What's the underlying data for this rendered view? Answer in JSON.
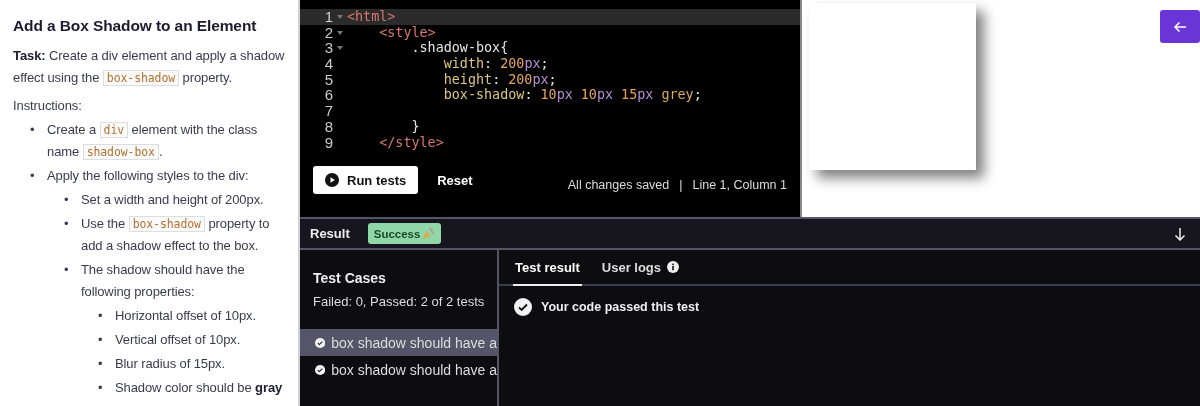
{
  "instructions": {
    "title": "Add a Box Shadow to an Element",
    "task": [
      {
        "kind": "text",
        "t": "**Task:** Create a div element and apply a shadow effect using the "
      },
      {
        "kind": "code",
        "t": "box-shadow"
      },
      {
        "kind": "text",
        "t": " property."
      }
    ],
    "subtitle": "Instructions:",
    "items": [
      {
        "bullet": "•",
        "parts": [
          {
            "kind": "text",
            "t": "Create a "
          },
          {
            "kind": "code",
            "t": "div"
          },
          {
            "kind": "text",
            "t": " element with the class name "
          },
          {
            "kind": "code",
            "t": "shadow-box"
          },
          {
            "kind": "text",
            "t": "."
          }
        ]
      },
      {
        "bullet": "•",
        "parts": [
          {
            "kind": "text",
            "t": "Apply the following styles to the div:"
          }
        ],
        "children": [
          {
            "bullet": "•",
            "parts": [
              {
                "kind": "text",
                "t": "Set a width and height of 200px."
              }
            ]
          },
          {
            "bullet": "•",
            "parts": [
              {
                "kind": "text",
                "t": "Use the "
              },
              {
                "kind": "code",
                "t": "box-shadow"
              },
              {
                "kind": "text",
                "t": " property to add a shadow effect to the box."
              }
            ]
          },
          {
            "bullet": "•",
            "parts": [
              {
                "kind": "text",
                "t": "The shadow should have the following properties:"
              }
            ],
            "children": [
              {
                "bullet": "•",
                "parts": [
                  {
                    "kind": "text",
                    "t": "Horizontal offset of 10px."
                  }
                ]
              },
              {
                "bullet": "•",
                "parts": [
                  {
                    "kind": "text",
                    "t": "Vertical offset of 10px."
                  }
                ]
              },
              {
                "bullet": "•",
                "parts": [
                  {
                    "kind": "text",
                    "t": "Blur radius of 15px."
                  }
                ]
              },
              {
                "bullet": "•",
                "parts": [
                  {
                    "kind": "text",
                    "t": "Shadow color should be **gray**"
                  }
                ]
              }
            ]
          }
        ]
      }
    ]
  },
  "editor": {
    "lines": [
      {
        "number": "1",
        "fold": true,
        "active": true,
        "tokens": [
          {
            "kind": "tag",
            "t": "<html>"
          }
        ]
      },
      {
        "number": "2",
        "fold": true,
        "active": false,
        "tokens": [
          {
            "kind": "tag",
            "t": "    <style>"
          }
        ]
      },
      {
        "number": "3",
        "fold": true,
        "active": false,
        "tokens": [
          {
            "kind": "plain",
            "t": "        .shadow-box{"
          }
        ]
      },
      {
        "number": "4",
        "fold": false,
        "active": false,
        "tokens": [
          {
            "kind": "prop",
            "t": "            width"
          },
          {
            "kind": "plain",
            "t": ":"
          },
          {
            "kind": "num",
            "t": " 200"
          },
          {
            "kind": "unit",
            "t": "px"
          },
          {
            "kind": "plain",
            "t": ";"
          }
        ]
      },
      {
        "number": "5",
        "fold": false,
        "active": false,
        "tokens": [
          {
            "kind": "prop",
            "t": "            height"
          },
          {
            "kind": "plain",
            "t": ":"
          },
          {
            "kind": "num",
            "t": " 200"
          },
          {
            "kind": "unit",
            "t": "px"
          },
          {
            "kind": "plain",
            "t": ";"
          }
        ]
      },
      {
        "number": "6",
        "fold": false,
        "active": false,
        "tokens": [
          {
            "kind": "prop",
            "t": "            box-shadow"
          },
          {
            "kind": "plain",
            "t": ":"
          },
          {
            "kind": "num",
            "t": " 10"
          },
          {
            "kind": "unit",
            "t": "px"
          },
          {
            "kind": "num",
            "t": " 10"
          },
          {
            "kind": "unit",
            "t": "px"
          },
          {
            "kind": "num",
            "t": " 15"
          },
          {
            "kind": "unit",
            "t": "px"
          },
          {
            "kind": "value",
            "t": " grey"
          },
          {
            "kind": "plain",
            "t": ";"
          }
        ]
      },
      {
        "number": "7",
        "fold": false,
        "active": false
      },
      {
        "number": "8",
        "fold": false,
        "active": false,
        "tokens": [
          {
            "kind": "plain",
            "t": "        }"
          }
        ]
      },
      {
        "number": "9",
        "fold": false,
        "active": false,
        "tokens": [
          {
            "kind": "tag",
            "t": "    </style>"
          }
        ]
      }
    ],
    "run_button": "Run tests",
    "reset_button": "Reset",
    "save_status": "All changes saved",
    "separator": "|",
    "cursor_position": "Line 1, Column 1"
  },
  "result_bar": {
    "label": "Result",
    "badge": "Success"
  },
  "test_cases": {
    "title": "Test Cases",
    "summary": "Failed: 0, Passed: 2 of 2 tests",
    "items": [
      {
        "label": "box shadow should have a",
        "passed": true,
        "selected": true
      },
      {
        "label": "box shadow should have a",
        "passed": true,
        "selected": false
      }
    ]
  },
  "result_tabs": [
    {
      "label": "Test result",
      "selected": true,
      "info": false
    },
    {
      "label": "User logs",
      "selected": false,
      "info": true
    }
  ],
  "test_result": {
    "message": "Your code passed this test",
    "passed": true
  }
}
